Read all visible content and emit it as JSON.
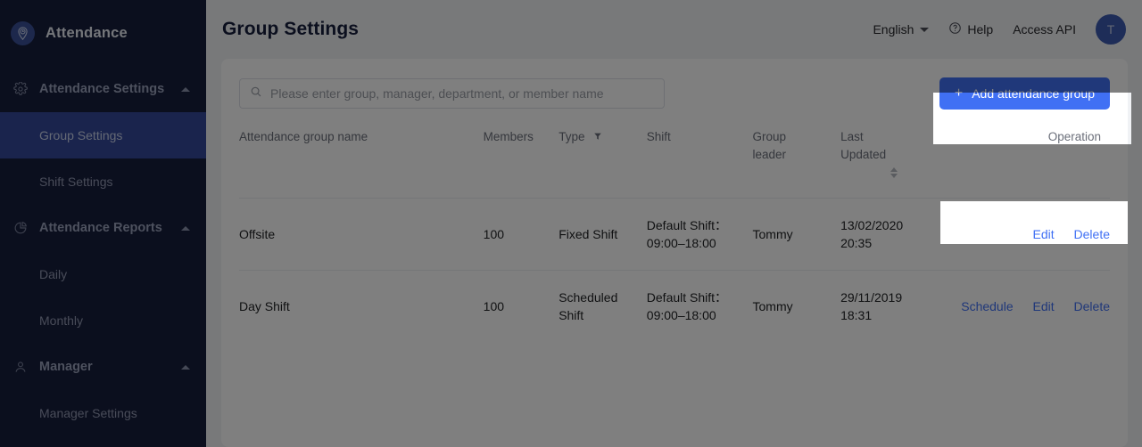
{
  "sidebar": {
    "brand": {
      "label": "Attendance",
      "icon": "clock-pin-icon"
    },
    "groups": [
      {
        "label": "Attendance Settings",
        "icon": "gear-icon",
        "expanded": true,
        "items": [
          {
            "label": "Group Settings",
            "active": true
          },
          {
            "label": "Shift Settings",
            "active": false
          }
        ]
      },
      {
        "label": "Attendance Reports",
        "icon": "pie-chart-icon",
        "expanded": true,
        "items": [
          {
            "label": "Daily",
            "active": false
          },
          {
            "label": "Monthly",
            "active": false
          }
        ]
      },
      {
        "label": "Manager",
        "icon": "user-icon",
        "expanded": true,
        "items": [
          {
            "label": "Manager Settings",
            "active": false
          }
        ]
      }
    ]
  },
  "header": {
    "title": "Group Settings",
    "language": "English",
    "help": "Help",
    "access_api": "Access API",
    "avatar_initial": "T"
  },
  "toolbar": {
    "search_placeholder": "Please enter group, manager, department, or member name",
    "search_value": "",
    "add_button": "Add attendance group",
    "add_button_plus": "+"
  },
  "table": {
    "columns": [
      "Attendance group name",
      "Members",
      "Type",
      "Shift",
      "Group\nleader",
      "Last\nUpdated",
      "Operation"
    ],
    "rows": [
      {
        "name": "Offsite",
        "members": "100",
        "type": "Fixed Shift",
        "shift": "Default Shift：\n09:00–18:00",
        "leader": "Tommy",
        "updated": "13/02/2020\n20:35",
        "ops": [
          "Edit",
          "Delete"
        ]
      },
      {
        "name": "Day Shift",
        "members": "100",
        "type": "Scheduled\nShift",
        "shift": "Default Shift：\n09:00–18:00",
        "leader": "Tommy",
        "updated": "29/11/2019\n18:31",
        "ops": [
          "Schedule",
          "Edit",
          "Delete"
        ]
      }
    ]
  },
  "colors": {
    "sidebar_bg": "#171e3c",
    "sidebar_active": "#35489a",
    "accent": "#4070f4",
    "page_bg": "#f0f2f5",
    "link": "#4070f4"
  }
}
